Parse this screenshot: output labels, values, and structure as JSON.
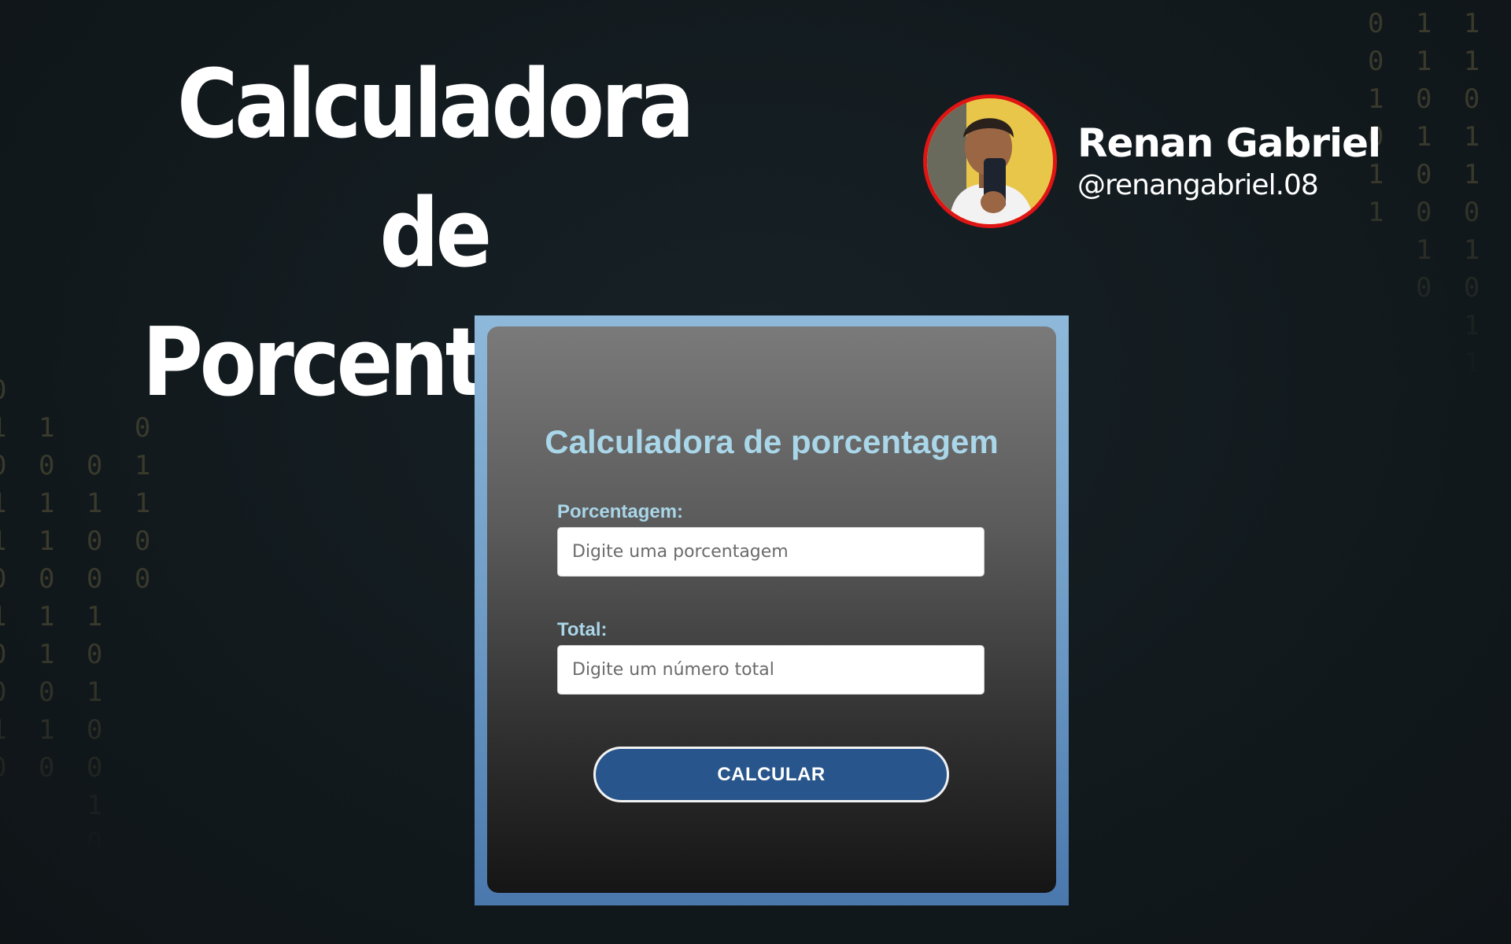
{
  "header": {
    "title_line1": "Calculadora de",
    "title_line2": "Porcentagem"
  },
  "author": {
    "name": "Renan Gabriel",
    "handle": "@renangabriel.08"
  },
  "decor": {
    "binary_right": "0 1 1 1 1\n0 1 1 0 0\n1 0 0 0 0\n0 1 1 1\n1 0 1 0\n1 0 0 1\n  1 1 0\n  0 0 0\n    1 1\n    1 0",
    "binary_left": "0\n1 1   0\n0 0 0 1\n1 1 1 1\n1 1 0 0\n0 0 0 0\n1 1 1\n0 1 0\n0 0 1\n1 1 0\n0 0 0\n    1\n    0"
  },
  "calculator": {
    "title": "Calculadora de porcentagem",
    "percent_label": "Porcentagem:",
    "percent_placeholder": "Digite uma porcentagem",
    "percent_value": "",
    "total_label": "Total:",
    "total_placeholder": "Digite um número total",
    "total_value": "",
    "button_label": "CALCULAR"
  },
  "colors": {
    "accent_text": "#a9d6e8",
    "button_bg": "#28558c",
    "avatar_border": "#e01414",
    "frame": "#6f9cc6"
  }
}
